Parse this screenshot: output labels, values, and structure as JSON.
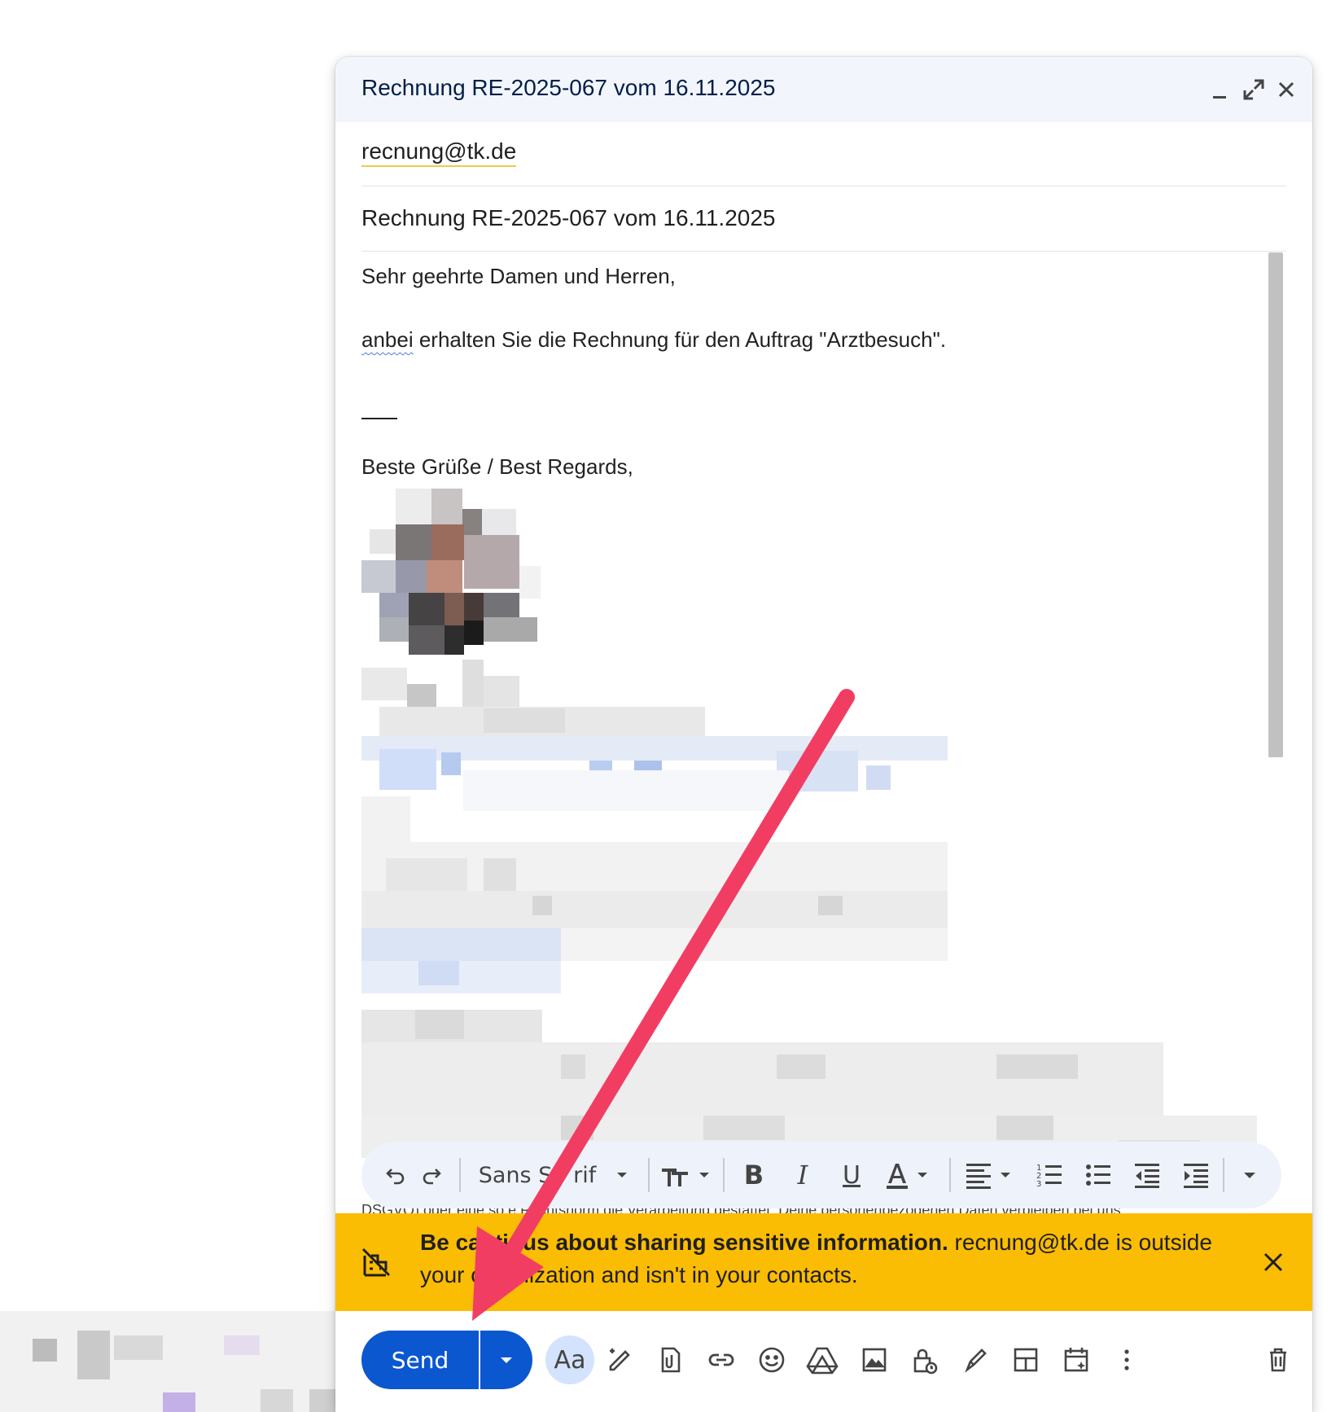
{
  "compose": {
    "title": "Rechnung RE-2025-067 vom 16.11.2025",
    "to": "recnung@tk.de",
    "subject": "Rechnung RE-2025-067 vom 16.11.2025",
    "body": {
      "greeting": "Sehr geehrte Damen und Herren,",
      "line_first_word": "anbei",
      "line_rest": " erhalten Sie die Rechnung für den Auftrag \"Arztbesuch\".",
      "closing": "Beste Grüße / Best Regards,",
      "footer_letter": "D",
      "footer_partial": "DSGVO) oder eine so     e Rechtsnorm die Verarbeitung gestattet. Deine personenbezogenen Daten verbleiben bei uns"
    }
  },
  "toolbar": {
    "font": "Sans Serif",
    "font_visible": "Sans S   rif"
  },
  "warning": {
    "bold": "Be cautious about sharing sensitive information.",
    "rest": " recnung@tk.de is outside your organization and isn't in your contacts."
  },
  "actions": {
    "send_label": "Send",
    "format_label": "Aa"
  },
  "colors": {
    "send": "#0b57d0",
    "warning": "#fbbc04",
    "title_bar": "#f2f6fc",
    "arrow": "#f23d63"
  }
}
